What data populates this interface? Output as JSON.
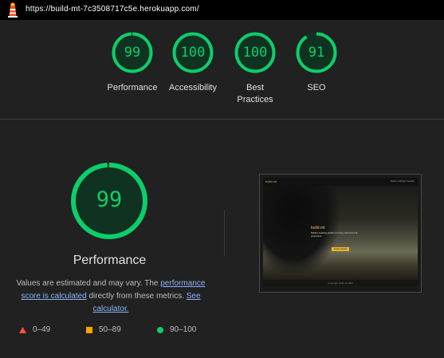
{
  "topbar": {
    "url": "https://build-mt-7c3508717c5e.herokuapp.com/",
    "logo_icon": "lighthouse-icon"
  },
  "gauges": [
    {
      "score": "99",
      "label": "Performance",
      "fraction": 0.99
    },
    {
      "score": "100",
      "label": "Accessibility",
      "fraction": 1.0
    },
    {
      "score": "100",
      "label": "Best Practices",
      "fraction": 1.0
    },
    {
      "score": "91",
      "label": "SEO",
      "fraction": 0.91
    }
  ],
  "main": {
    "score": "99",
    "fraction": 0.99,
    "title": "Performance",
    "desc_pre": "Values are estimated and may vary. The ",
    "desc_link1": "performance score is calculated",
    "desc_mid": " directly from these metrics. ",
    "desc_link2": "See calculator.",
    "desc_post": ""
  },
  "legend": [
    {
      "range": "0–49",
      "shape": "triangle",
      "color": "#ff4e42"
    },
    {
      "range": "50–89",
      "shape": "square",
      "color": "#ffa400"
    },
    {
      "range": "90–100",
      "shape": "circle",
      "color": "#0cce6b"
    }
  ],
  "screenshot": {
    "brand": "build.mt",
    "nav": "Home  Listings  Contact",
    "hero_title": "build.mt",
    "hero_sub": "Malta's leading platform to buy, sell and rent properties",
    "hero_button": "Explore Builds",
    "footer": "Copyright build.mt 2024"
  },
  "colors": {
    "pass": "#0cce6b",
    "pass_bg": "#0f3320",
    "background": "#212121"
  }
}
